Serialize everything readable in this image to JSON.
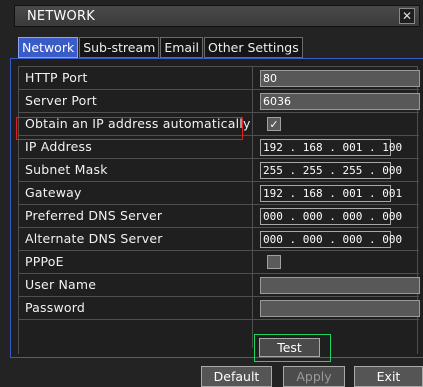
{
  "window": {
    "title": "NETWORK",
    "close_label": "✕"
  },
  "tabs": [
    "Network",
    "Sub-stream",
    "Email",
    "Other Settings"
  ],
  "active_tab": "Network",
  "rows": {
    "http_port": {
      "label": "HTTP Port",
      "value": "80"
    },
    "server_port": {
      "label": "Server Port",
      "value": "6036"
    },
    "dhcp": {
      "label": "Obtain an IP address automatically",
      "checked": true
    },
    "ip_address": {
      "label": "IP Address",
      "value": "192 . 168 . 001 . 100"
    },
    "subnet_mask": {
      "label": "Subnet Mask",
      "value": "255 . 255 . 255 . 000"
    },
    "gateway": {
      "label": "Gateway",
      "value": "192 . 168 . 001 . 001"
    },
    "preferred_dns": {
      "label": "Preferred DNS Server",
      "value": "000 . 000 . 000 . 000"
    },
    "alternate_dns": {
      "label": "Alternate DNS Server",
      "value": "000 . 000 . 000 . 000"
    },
    "pppoe": {
      "label": "PPPoE",
      "checked": false
    },
    "user_name": {
      "label": "User Name",
      "value": ""
    },
    "password": {
      "label": "Password",
      "value": ""
    }
  },
  "buttons": {
    "test": "Test",
    "default": "Default",
    "apply": "Apply",
    "exit": "Exit"
  },
  "highlight_colors": {
    "red": "#e02020",
    "green": "#1fd460",
    "tab_active": "#3a5cc8"
  }
}
